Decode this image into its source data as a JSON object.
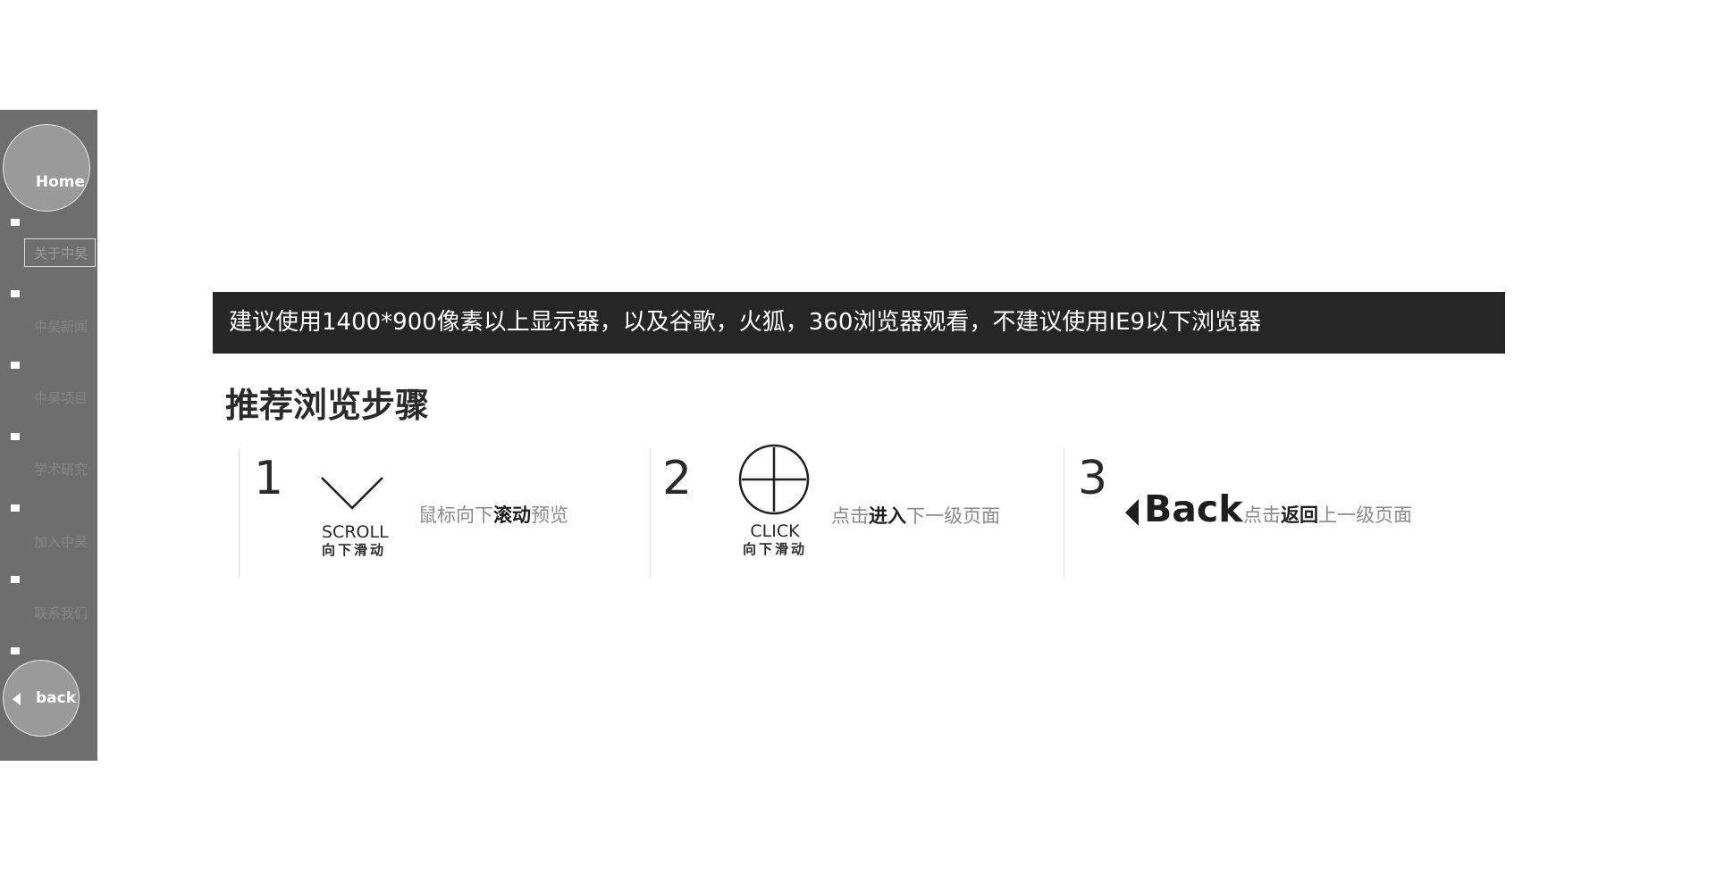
{
  "sidebar": {
    "home_label": "Home",
    "back_label": "back",
    "items": [
      {
        "label": "关于中昊"
      },
      {
        "label": "中昊新闻"
      },
      {
        "label": "中昊项目"
      },
      {
        "label": "学术研究"
      },
      {
        "label": "加入中昊"
      },
      {
        "label": "联系我们"
      }
    ]
  },
  "notice": "建议使用1400*900像素以上显示器，以及谷歌，火狐，360浏览器观看，不建议使用IE9以下浏览器",
  "section_title": "推荐浏览步骤",
  "steps": [
    {
      "number": "1",
      "icon_caption_en": "SCROLL",
      "icon_caption_zh": "向下滑动",
      "desc_pre": "鼠标向下",
      "desc_hl": "滚动",
      "desc_post": "预览"
    },
    {
      "number": "2",
      "icon_caption_en": "CLICK",
      "icon_caption_zh": "向下滑动",
      "desc_pre": "点击",
      "desc_hl": "进入",
      "desc_post": "下一级页面"
    },
    {
      "number": "3",
      "icon_label": "Back",
      "desc_pre": "点击",
      "desc_hl": "返回",
      "desc_post": "上一级页面"
    }
  ]
}
